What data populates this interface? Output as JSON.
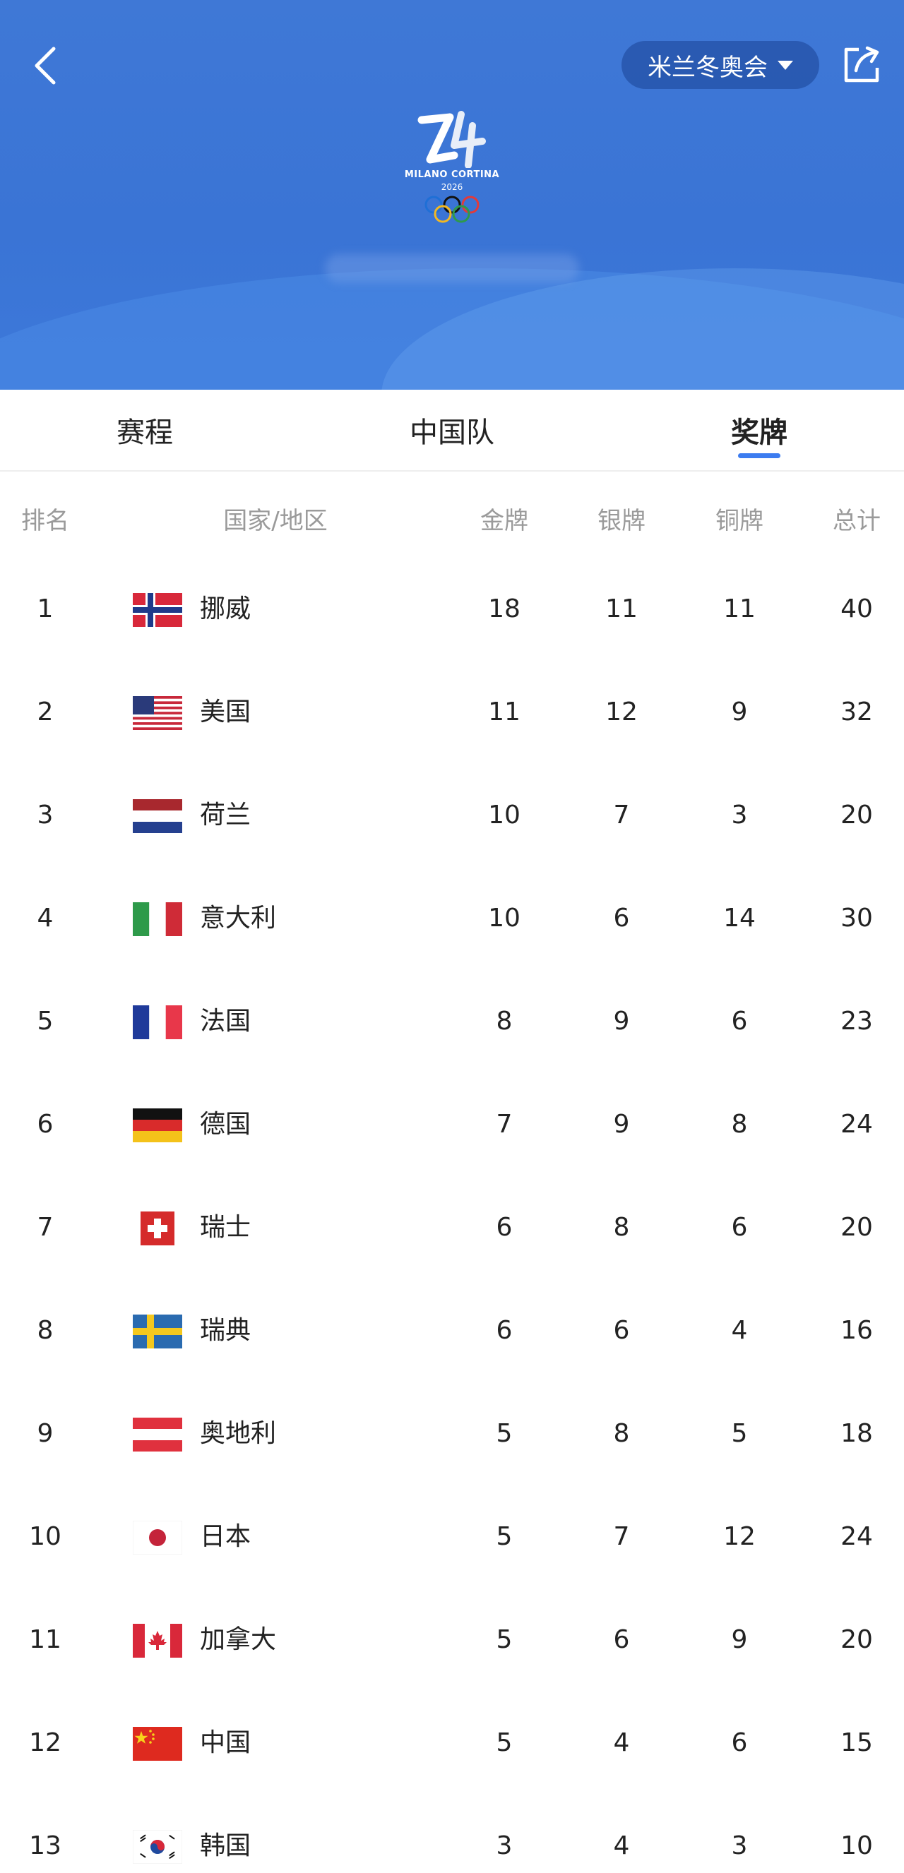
{
  "header": {
    "games_selector_label": "米兰冬奥会",
    "logo_text": "MILANO CORTINA",
    "logo_year": "2026"
  },
  "tabs": [
    {
      "label": "赛程",
      "active": false
    },
    {
      "label": "中国队",
      "active": false
    },
    {
      "label": "奖牌",
      "active": true
    }
  ],
  "columns": {
    "rank": "排名",
    "country": "国家/地区",
    "gold": "金牌",
    "silver": "银牌",
    "bronze": "铜牌",
    "total": "总计"
  },
  "accent_color": "#3c7cf0",
  "rows": [
    {
      "rank": "1",
      "country": "挪威",
      "flag": "norway-flag-icon",
      "gold": "18",
      "silver": "11",
      "bronze": "11",
      "total": "40"
    },
    {
      "rank": "2",
      "country": "美国",
      "flag": "usa-flag-icon",
      "gold": "11",
      "silver": "12",
      "bronze": "9",
      "total": "32"
    },
    {
      "rank": "3",
      "country": "荷兰",
      "flag": "netherlands-flag-icon",
      "gold": "10",
      "silver": "7",
      "bronze": "3",
      "total": "20"
    },
    {
      "rank": "4",
      "country": "意大利",
      "flag": "italy-flag-icon",
      "gold": "10",
      "silver": "6",
      "bronze": "14",
      "total": "30"
    },
    {
      "rank": "5",
      "country": "法国",
      "flag": "france-flag-icon",
      "gold": "8",
      "silver": "9",
      "bronze": "6",
      "total": "23"
    },
    {
      "rank": "6",
      "country": "德国",
      "flag": "germany-flag-icon",
      "gold": "7",
      "silver": "9",
      "bronze": "8",
      "total": "24"
    },
    {
      "rank": "7",
      "country": "瑞士",
      "flag": "switzerland-flag-icon",
      "gold": "6",
      "silver": "8",
      "bronze": "6",
      "total": "20"
    },
    {
      "rank": "8",
      "country": "瑞典",
      "flag": "sweden-flag-icon",
      "gold": "6",
      "silver": "6",
      "bronze": "4",
      "total": "16"
    },
    {
      "rank": "9",
      "country": "奥地利",
      "flag": "austria-flag-icon",
      "gold": "5",
      "silver": "8",
      "bronze": "5",
      "total": "18"
    },
    {
      "rank": "10",
      "country": "日本",
      "flag": "japan-flag-icon",
      "gold": "5",
      "silver": "7",
      "bronze": "12",
      "total": "24"
    },
    {
      "rank": "11",
      "country": "加拿大",
      "flag": "canada-flag-icon",
      "gold": "5",
      "silver": "6",
      "bronze": "9",
      "total": "20"
    },
    {
      "rank": "12",
      "country": "中国",
      "flag": "china-flag-icon",
      "gold": "5",
      "silver": "4",
      "bronze": "6",
      "total": "15"
    },
    {
      "rank": "13",
      "country": "韩国",
      "flag": "korea-flag-icon",
      "gold": "3",
      "silver": "4",
      "bronze": "3",
      "total": "10"
    }
  ]
}
